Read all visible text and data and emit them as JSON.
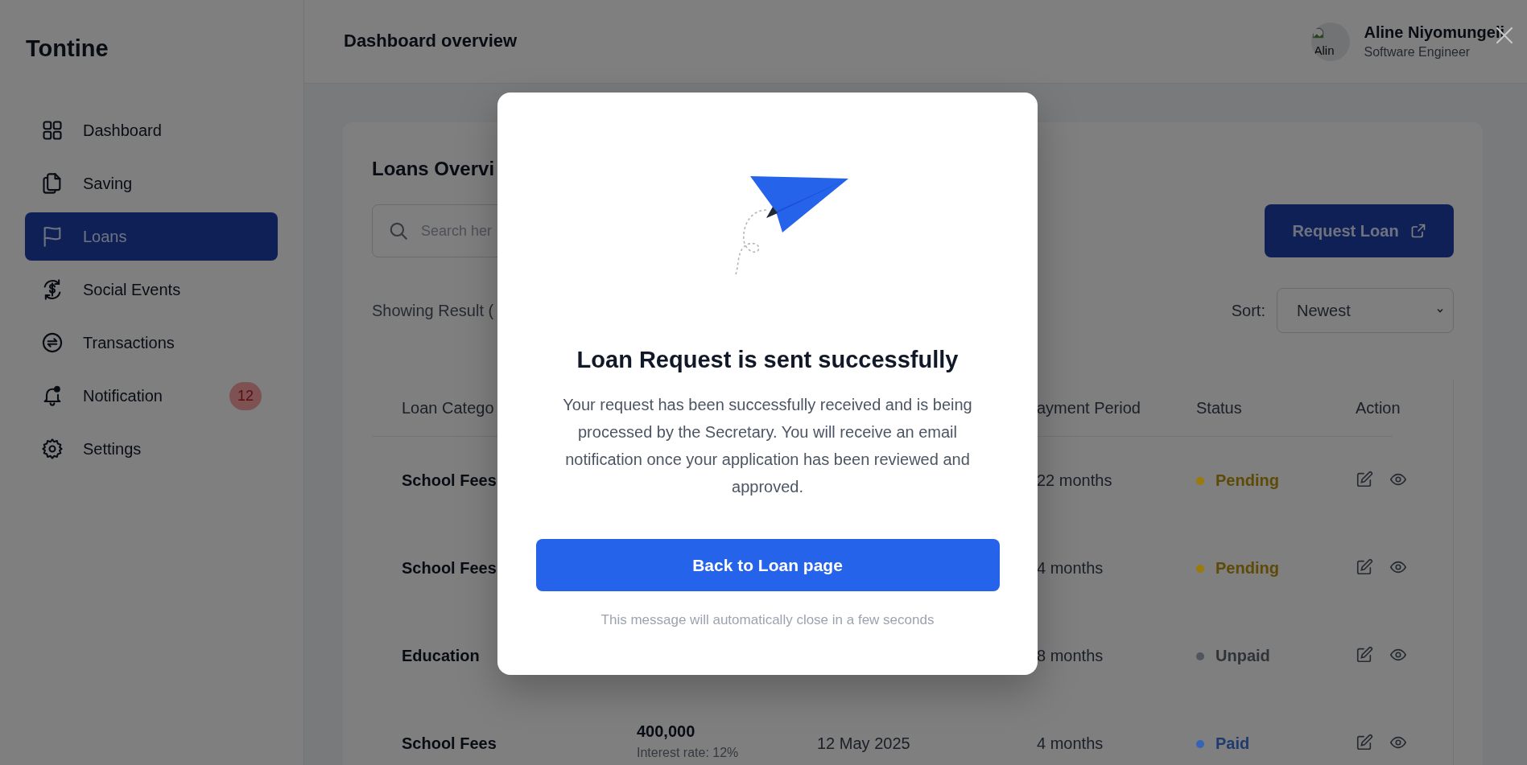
{
  "sidebar": {
    "brand": "Tontine",
    "items": [
      {
        "label": "Dashboard",
        "selected": false
      },
      {
        "label": "Saving",
        "selected": false
      },
      {
        "label": "Loans",
        "selected": true
      },
      {
        "label": "Social Events",
        "selected": false
      },
      {
        "label": "Transactions",
        "selected": false
      },
      {
        "label": "Notification",
        "selected": false,
        "badge": "12"
      },
      {
        "label": "Settings",
        "selected": false
      }
    ]
  },
  "header": {
    "title": "Dashboard overview",
    "user": {
      "avatar_alt": "Alin",
      "name": "Aline Niyomungeli",
      "role": "Software Engineer"
    }
  },
  "loans": {
    "title": "Loans Overvi",
    "search": {
      "placeholder": "Search her"
    },
    "request_button": "Request Loan",
    "result_text": "Showing Result (",
    "sort": {
      "label": "Sort:",
      "value": "Newest"
    },
    "table": {
      "columns": [
        "Loan Catego",
        "ayment Period",
        "Status",
        "Action"
      ],
      "rows": [
        {
          "category": "School Fees",
          "period": "22 months",
          "status": {
            "label": "Pending",
            "color": "#9a7b0a"
          }
        },
        {
          "category": "School Fees",
          "period": "4 months",
          "status": {
            "label": "Pending",
            "color": "#9a7b0a"
          }
        },
        {
          "category": "Education",
          "period": "8 months",
          "status": {
            "label": "Unpaid",
            "color": "#50555e"
          }
        },
        {
          "category": "School Fees",
          "amount": "400,000",
          "interest": "Interest rate: 12%",
          "date": "12 May 2025",
          "period": "4 months",
          "status": {
            "label": "Paid",
            "color": "#3463b8"
          }
        }
      ]
    }
  },
  "modal": {
    "title": "Loan Request is sent successfully",
    "message": "Your request has been successfully received and is being processed by the Secretary. You will receive an email notification once your application has been reviewed and approved.",
    "button": "Back to Loan page",
    "note": "This message will automatically close in a few seconds"
  }
}
